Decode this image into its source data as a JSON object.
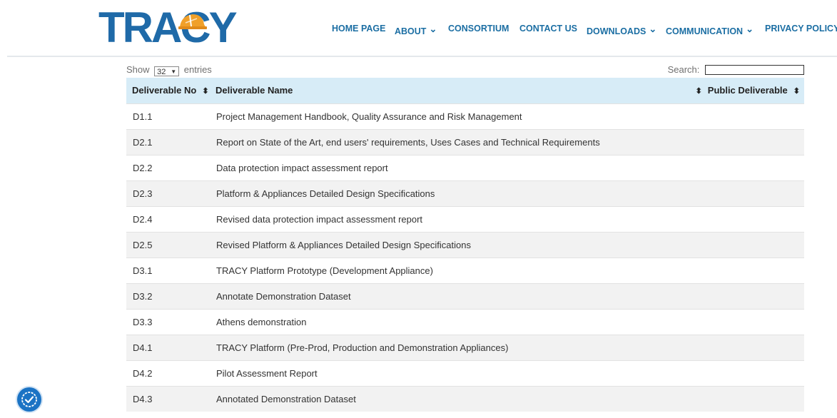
{
  "header": {
    "logo_text": "TRACY",
    "nav": [
      {
        "label": "HOME PAGE",
        "dropdown": false
      },
      {
        "label": "ABOUT",
        "dropdown": true
      },
      {
        "label": "CONSORTIUM",
        "dropdown": false
      },
      {
        "label": "CONTACT US",
        "dropdown": false
      },
      {
        "label": "DOWNLOADS",
        "dropdown": true
      },
      {
        "label": "COMMUNICATION",
        "dropdown": true
      },
      {
        "label": "PRIVACY POLICY",
        "dropdown": false
      }
    ]
  },
  "table_controls": {
    "show_label": "Show",
    "entries_value": "32",
    "entries_label": "entries",
    "search_label": "Search:",
    "search_value": ""
  },
  "table": {
    "columns": [
      "Deliverable No",
      "Deliverable Name",
      "Public Deliverable"
    ],
    "rows": [
      [
        "D1.1",
        "Project Management Handbook, Quality Assurance and Risk Management",
        ""
      ],
      [
        "D2.1",
        "Report on State of the Art, end users' requirements, Uses Cases and Technical Requirements",
        ""
      ],
      [
        "D2.2",
        "Data protection impact assessment report",
        ""
      ],
      [
        "D2.3",
        "Platform & Appliances Detailed Design Specifications",
        ""
      ],
      [
        "D2.4",
        "Revised data protection impact assessment report",
        ""
      ],
      [
        "D2.5",
        "Revised Platform & Appliances Detailed Design Specifications",
        ""
      ],
      [
        "D3.1",
        "TRACY Platform Prototype (Development Appliance)",
        ""
      ],
      [
        "D3.2",
        "Annotate Demonstration Dataset",
        ""
      ],
      [
        "D3.3",
        "Athens demonstration",
        ""
      ],
      [
        "D4.1",
        "TRACY Platform (Pre-Prod, Production and Demonstration Appliances)",
        ""
      ],
      [
        "D4.2",
        "Pilot Assessment Report",
        ""
      ],
      [
        "D4.3",
        "Annotated Demonstration Dataset",
        ""
      ]
    ]
  },
  "colors": {
    "brand_blue": "#1f6aa8",
    "nav_text": "#1b6ea3",
    "header_row_bg": "#d7ecf7",
    "stripe_bg": "#f2f2f2",
    "logo_accent": "#f0a02a",
    "accessibility_btn": "#1b73c4"
  },
  "icons": {
    "accessibility": "accessibility-check-icon",
    "sort": "sort-both-icon",
    "dropdown": "chevron-down-icon"
  }
}
